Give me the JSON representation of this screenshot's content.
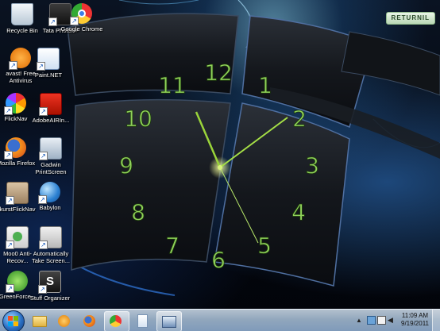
{
  "desktop_icons": [
    {
      "label": "Recycle Bin",
      "icon": "recycle-bin-icon"
    },
    {
      "label": "Tata Photon+",
      "icon": "tata-photon-icon"
    },
    {
      "label": "Google Chrome",
      "icon": "chrome-icon"
    },
    {
      "label": "avast! Free Antivirus",
      "icon": "avast-icon"
    },
    {
      "label": "Paint.NET",
      "icon": "paint-net-icon"
    },
    {
      "label": "FlickNav",
      "icon": "flicknav-icon"
    },
    {
      "label": "AdobeAIRIn...",
      "icon": "adobe-air-icon"
    },
    {
      "label": "Mozilla Firefox",
      "icon": "firefox-icon"
    },
    {
      "label": "Gadwin PrintScreen",
      "icon": "gadwin-icon"
    },
    {
      "label": "kurstFlickNav",
      "icon": "kurstflicknav-icon"
    },
    {
      "label": "Babylon",
      "icon": "babylon-icon"
    },
    {
      "label": "Moo0 Anti-Recov...",
      "icon": "moo0-icon"
    },
    {
      "label": "Automatically Take Screen...",
      "icon": "auto-screenshot-icon"
    },
    {
      "label": "GreenForce...",
      "icon": "greenforce-icon"
    },
    {
      "label": "Stuff Organizer",
      "icon": "stuff-organizer-icon"
    }
  ],
  "badge": {
    "text": "RETURNIL"
  },
  "clock_widget": {
    "numbers": [
      "12",
      "1",
      "2",
      "3",
      "4",
      "5",
      "6",
      "7",
      "8",
      "9",
      "10",
      "11"
    ],
    "time": "11:09"
  },
  "taskbar": {
    "pinned": [
      {
        "name": "explorer",
        "icon": "folder-icon"
      },
      {
        "name": "media-player",
        "icon": "media-player-icon"
      },
      {
        "name": "firefox",
        "icon": "firefox-icon"
      },
      {
        "name": "chrome",
        "icon": "chrome-icon",
        "active": true
      },
      {
        "name": "notepad",
        "icon": "notepad-icon"
      },
      {
        "name": "screenshot",
        "icon": "screenshot-icon",
        "active": true
      }
    ],
    "clock_time": "11:09 AM",
    "clock_date": "9/19/2011"
  },
  "colors": {
    "clock_green": "#8fd15a",
    "glow_blue": "#3c96ff"
  }
}
